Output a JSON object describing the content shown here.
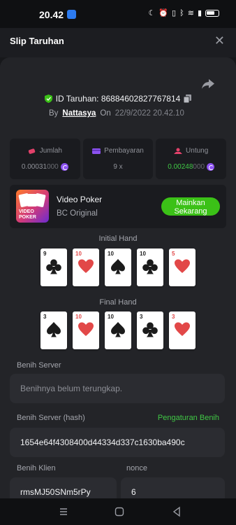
{
  "status_bar": {
    "time": "20.42",
    "battery_level": 0.8
  },
  "header": {
    "title": "Slip Taruhan",
    "close_icon": "close-icon"
  },
  "bet": {
    "id_text": "ID Taruhan: 86884602827767814",
    "by_label": "By",
    "username": "Nattasya",
    "on_label": "On",
    "date": "22/9/2022 20.42.10"
  },
  "stats": {
    "amount": {
      "label": "Jumlah",
      "value": "0.00031",
      "value_suffix": "000"
    },
    "payout": {
      "label": "Pembayaran",
      "value": "9 x"
    },
    "profit": {
      "label": "Untung",
      "value": "0.00248",
      "value_suffix": "000"
    }
  },
  "game": {
    "name": "Video Poker",
    "provider": "BC Original",
    "play_line1": "Mainkan",
    "play_line2": "Sekarang",
    "thumb_line1": "VIDEO",
    "thumb_line2": "POKER"
  },
  "initial_hand": {
    "label": "Initial Hand",
    "cards": [
      {
        "rank": "9",
        "suit": "club"
      },
      {
        "rank": "10",
        "suit": "heart"
      },
      {
        "rank": "10",
        "suit": "spade"
      },
      {
        "rank": "10",
        "suit": "club"
      },
      {
        "rank": "5",
        "suit": "heart"
      }
    ]
  },
  "final_hand": {
    "label": "Final Hand",
    "cards": [
      {
        "rank": "3",
        "suit": "spade"
      },
      {
        "rank": "10",
        "suit": "heart"
      },
      {
        "rank": "10",
        "suit": "spade"
      },
      {
        "rank": "3",
        "suit": "club"
      },
      {
        "rank": "3",
        "suit": "heart"
      }
    ]
  },
  "seeds": {
    "server_label": "Benih Server",
    "server_placeholder": "Benihnya belum terungkap.",
    "server_hash_label": "Benih Server (hash)",
    "settings_link": "Pengaturan Benih",
    "server_hash_value": "1654e64f4308400d44334d337c1630ba490c",
    "client_label": "Benih Klien",
    "client_value": "rmsMJ50SNm5rPy",
    "nonce_label": "nonce",
    "nonce_value": "6"
  },
  "colors": {
    "accent_green": "#3bc117",
    "coin_purple": "#8c52f0",
    "suit_red": "#e24848"
  }
}
